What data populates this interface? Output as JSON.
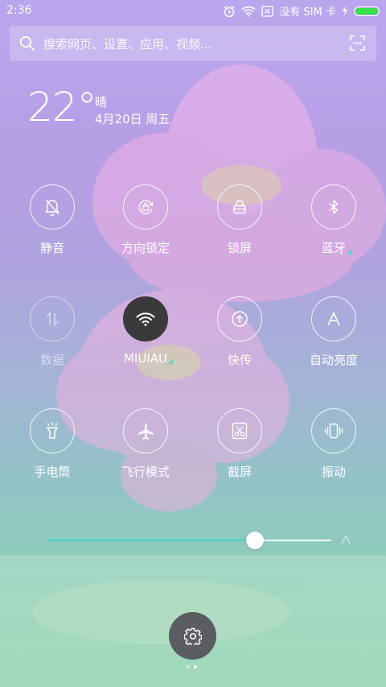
{
  "status_bar": {
    "time": "2:36",
    "no_sim_text": "没有 SIM 卡",
    "battery_color": "#34e24a",
    "battery_level": 1.0
  },
  "search": {
    "placeholder": "搜索网页、设置、应用、视频..."
  },
  "weather": {
    "temperature": "22°",
    "condition": "晴",
    "date": "4月20日 周五"
  },
  "toggles": [
    {
      "label": "静音",
      "icon": "bell-off-icon",
      "active": false
    },
    {
      "label": "方向锁定",
      "icon": "rotation-lock-icon",
      "active": false
    },
    {
      "label": "锁屏",
      "icon": "lock-icon",
      "active": false
    },
    {
      "label": "蓝牙",
      "icon": "bluetooth-icon",
      "active": false,
      "has_more": true
    },
    {
      "label": "数据",
      "icon": "mobile-data-icon",
      "active": false,
      "disabled": true
    },
    {
      "label": "MIUIAU",
      "icon": "wifi-icon",
      "active": true,
      "has_more": true
    },
    {
      "label": "快传",
      "icon": "share-upload-icon",
      "active": false
    },
    {
      "label": "自动亮度",
      "icon": "auto-brightness-icon",
      "active": false
    },
    {
      "label": "手电筒",
      "icon": "flashlight-icon",
      "active": false
    },
    {
      "label": "飞行模式",
      "icon": "airplane-icon",
      "active": false
    },
    {
      "label": "截屏",
      "icon": "screenshot-icon",
      "active": false
    },
    {
      "label": "振动",
      "icon": "vibrate-icon",
      "active": false
    }
  ],
  "brightness": {
    "level": 0.73,
    "accent": "#3bd6cb"
  },
  "settings": {
    "icon": "gear-icon"
  },
  "pager": {
    "pages": 2,
    "current": 1
  }
}
